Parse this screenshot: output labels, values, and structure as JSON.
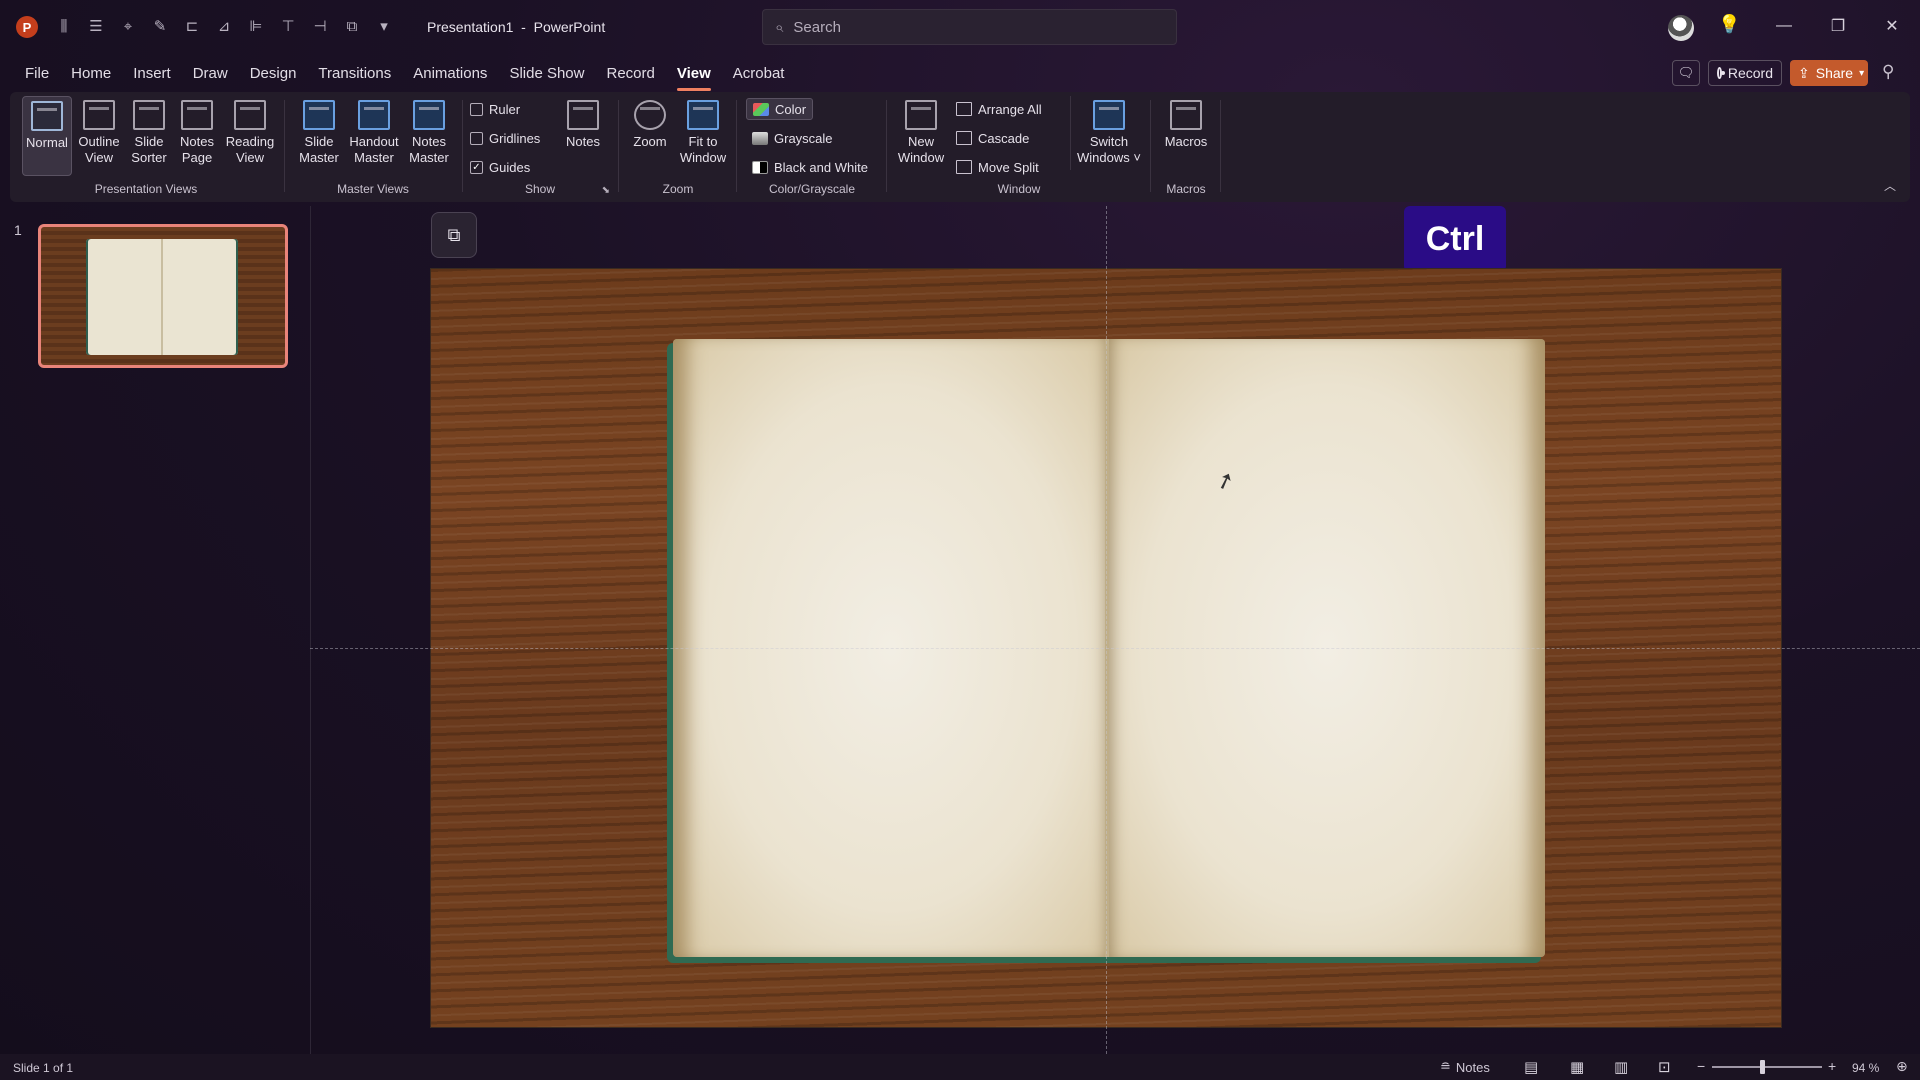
{
  "app": {
    "logo_letter": "P",
    "title": "Presentation1  -  PowerPoint"
  },
  "search": {
    "placeholder": "Search"
  },
  "qat_icons": [
    "autosave-icon",
    "align-icon",
    "draw-icon",
    "pen-icon",
    "arrange-icon",
    "crop-icon",
    "align-left-icon",
    "align-top-icon",
    "distribute-icon",
    "shape-icon",
    "customize-qat-icon"
  ],
  "tabs": [
    "File",
    "Home",
    "Insert",
    "Draw",
    "Design",
    "Transitions",
    "Animations",
    "Slide Show",
    "Record",
    "View",
    "Acrobat"
  ],
  "active_tab": "View",
  "header_right": {
    "record_label": "Record",
    "share_label": "Share"
  },
  "ribbon": {
    "presentation_views": {
      "label": "Presentation Views",
      "buttons": [
        "Normal",
        "Outline\nView",
        "Slide\nSorter",
        "Notes\nPage",
        "Reading\nView"
      ]
    },
    "master_views": {
      "label": "Master Views",
      "buttons": [
        "Slide\nMaster",
        "Handout\nMaster",
        "Notes\nMaster"
      ]
    },
    "show": {
      "label": "Show",
      "checks": [
        {
          "label": "Ruler",
          "checked": false
        },
        {
          "label": "Gridlines",
          "checked": false
        },
        {
          "label": "Guides",
          "checked": true
        }
      ],
      "notes_label": "Notes"
    },
    "zoom": {
      "label": "Zoom",
      "buttons": [
        "Zoom",
        "Fit to\nWindow"
      ]
    },
    "color_grayscale": {
      "label": "Color/Grayscale",
      "options": [
        "Color",
        "Grayscale",
        "Black and White"
      ],
      "selected": "Color"
    },
    "window": {
      "label": "Window",
      "new_window": "New\nWindow",
      "options": [
        "Arrange All",
        "Cascade",
        "Move Split"
      ],
      "switch_windows": "Switch\nWindows ˅"
    },
    "macros": {
      "label": "Macros",
      "button": "Macros"
    }
  },
  "thumbnails": [
    {
      "number": "1"
    }
  ],
  "overlay": {
    "key_badge": "Ctrl"
  },
  "status": {
    "slide_count": "Slide 1 of 1",
    "notes_label": "Notes",
    "zoom_level": "94 %"
  }
}
